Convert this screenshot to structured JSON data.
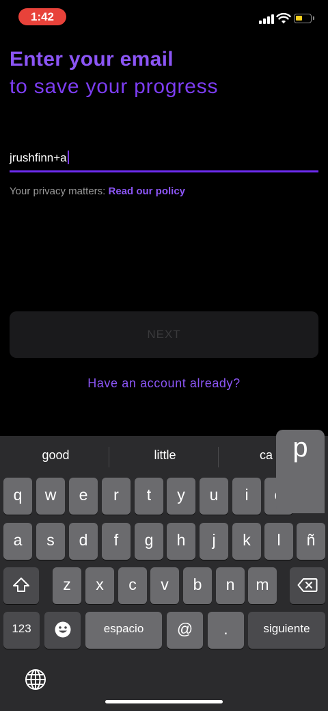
{
  "status_bar": {
    "time": "1:42"
  },
  "header": {
    "title_line1": "Enter your email",
    "title_line2": "to save your progress"
  },
  "email": {
    "value": "jrushfinn+a"
  },
  "privacy": {
    "prefix": "Your privacy matters: ",
    "link": "Read our policy"
  },
  "next_button": {
    "label": "NEXT"
  },
  "account_link": "Have an account already?",
  "keyboard": {
    "suggestions": [
      "good",
      "little",
      "ca"
    ],
    "popup_letter": "p",
    "row1": [
      "q",
      "w",
      "e",
      "r",
      "t",
      "y",
      "u",
      "i",
      "o"
    ],
    "row2": [
      "a",
      "s",
      "d",
      "f",
      "g",
      "h",
      "j",
      "k",
      "l",
      "ñ"
    ],
    "row3": [
      "z",
      "x",
      "c",
      "v",
      "b",
      "n",
      "m"
    ],
    "numbers_label": "123",
    "space_label": "espacio",
    "at_label": "@",
    "period_label": ".",
    "return_label": "siguiente",
    "icons": {
      "shift": "shift-icon",
      "delete": "delete-icon",
      "emoji": "emoji-icon",
      "globe": "globe-icon"
    }
  },
  "colors": {
    "accent": "#7c3df2",
    "accent_light": "#8b55f5",
    "time_pill": "#e8423a"
  }
}
